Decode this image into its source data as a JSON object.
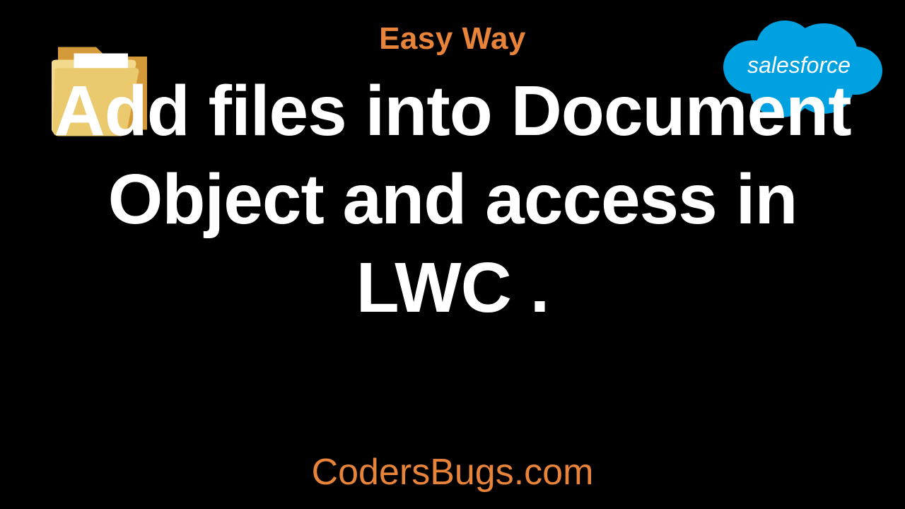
{
  "header": "Easy Way",
  "title": "Add files into Document Object and access in LWC .",
  "footer": "CodersBugs.com",
  "salesforce_label": "salesforce"
}
